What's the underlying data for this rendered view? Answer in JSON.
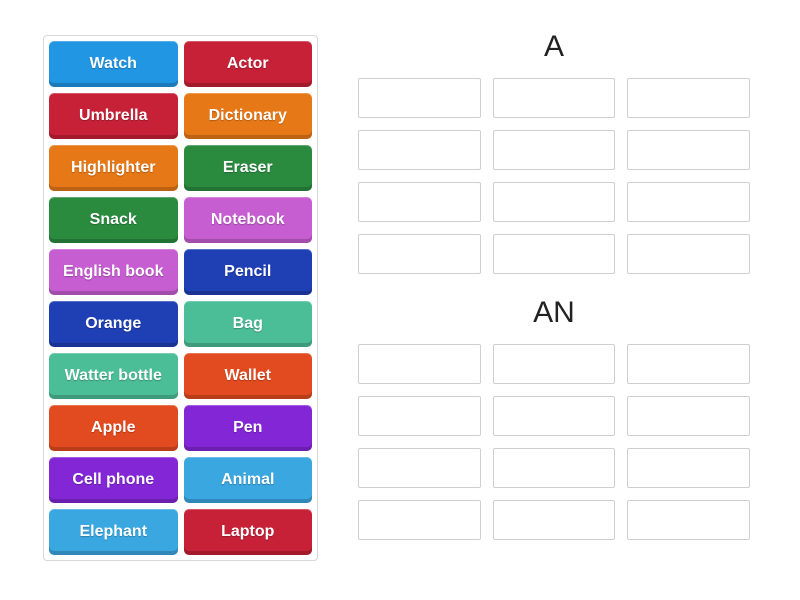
{
  "source": {
    "tiles": [
      {
        "label": "Watch",
        "color": "c-blue"
      },
      {
        "label": "Actor",
        "color": "c-red"
      },
      {
        "label": "Umbrella",
        "color": "c-red"
      },
      {
        "label": "Dictionary",
        "color": "c-orange"
      },
      {
        "label": "Highlighter",
        "color": "c-orange"
      },
      {
        "label": "Eraser",
        "color": "c-green"
      },
      {
        "label": "Snack",
        "color": "c-green"
      },
      {
        "label": "Notebook",
        "color": "c-magenta"
      },
      {
        "label": "English book",
        "color": "c-magenta"
      },
      {
        "label": "Pencil",
        "color": "c-navy"
      },
      {
        "label": "Orange",
        "color": "c-navy"
      },
      {
        "label": "Bag",
        "color": "c-teal"
      },
      {
        "label": "Watter bottle",
        "color": "c-teal"
      },
      {
        "label": "Wallet",
        "color": "c-deeporg"
      },
      {
        "label": "Apple",
        "color": "c-deeporg"
      },
      {
        "label": "Pen",
        "color": "c-purple"
      },
      {
        "label": "Cell phone",
        "color": "c-purple"
      },
      {
        "label": "Animal",
        "color": "c-ltblue"
      },
      {
        "label": "Elephant",
        "color": "c-ltblue"
      },
      {
        "label": "Laptop",
        "color": "c-red"
      }
    ]
  },
  "groups": [
    {
      "title": "A",
      "slots": 12
    },
    {
      "title": "AN",
      "slots": 12
    }
  ]
}
